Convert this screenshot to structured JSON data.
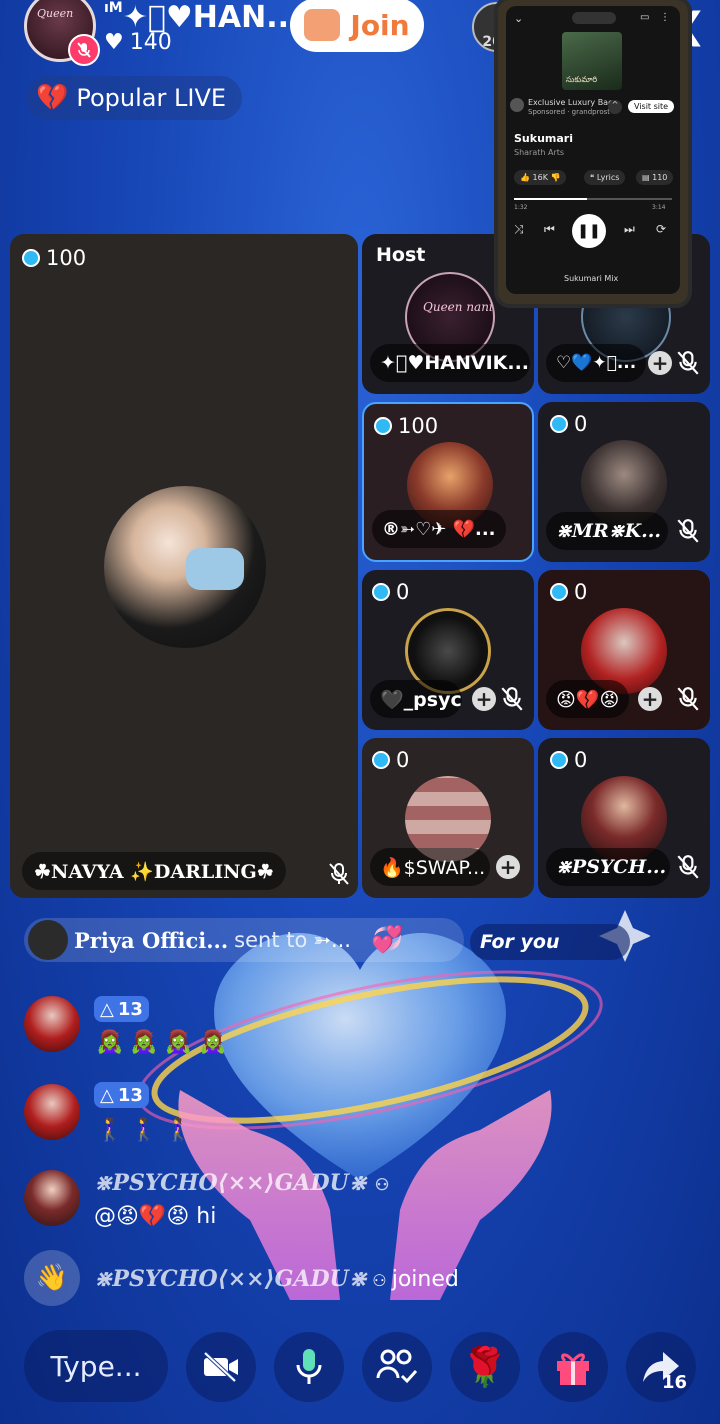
{
  "header": {
    "host_name": "✦⃝♥HAN...",
    "host_name_prefix": "ıM",
    "likes": "140",
    "join_label": "Join",
    "badge_text": "202",
    "popular_label": "Popular LIVE",
    "back_icon": "chevron-right-icon"
  },
  "mini_player": {
    "ad_title": "Exclusive Luxury Bag...",
    "ad_sub": "Sponsored · grandprost",
    "visit_label": "Visit site",
    "song": "Sukumari",
    "artist": "Sharath Arts",
    "likes": "16K",
    "lyrics_label": "Lyrics",
    "comments": "110",
    "elapsed": "1:32",
    "duration": "3:14",
    "progress": 0.46,
    "next_label": "Sukumari Mix",
    "cover_text": "సుకుమారి"
  },
  "seats": {
    "main": {
      "count": "100",
      "name": "☘NAVYA ✨DARLING☘"
    },
    "host": {
      "tag": "Host",
      "name": "✦⃝♥HANVIK...",
      "avatar_text": "Queen nani"
    },
    "seat2": {
      "name": "♡💙✦⃝..."
    },
    "seat3": {
      "count": "100",
      "name": "®➳♡✈ 💔..."
    },
    "seat4": {
      "count": "0",
      "name": "⋇MR⋇K..."
    },
    "seat5": {
      "count": "0",
      "name": "🖤_psyc..."
    },
    "seat6": {
      "count": "0",
      "name": "😡💔😡"
    },
    "seat7": {
      "count": "0",
      "name": "🔥$SWAP..."
    },
    "seat8": {
      "count": "0",
      "name": "⋇PSYCH..."
    }
  },
  "gift_banner": {
    "sender": "Priya Offici...",
    "sent_to": "sent to",
    "receiver": "➳...",
    "for_you": "For you"
  },
  "chat": [
    {
      "level": "13",
      "emojis": "🧟‍♀️ 🧟‍♀️ 🧟‍♀️ 🧟‍♀️"
    },
    {
      "level": "13",
      "emojis": "🚶‍♀️ 🚶‍♀️ 🚶‍♀️"
    },
    {
      "name": "⋇PSYCHO⟨××⟩GADU⋇",
      "message": "@😡💔😡 hi"
    },
    {
      "name": "⋇PSYCHO⟨××⟩GADU⋇",
      "message": "joined"
    }
  ],
  "bottom_bar": {
    "type_placeholder": "Type...",
    "share_count": "16"
  },
  "colors": {
    "background": "#1746b6",
    "join_text": "#f07a3c",
    "gift_box": "#ff4b7d",
    "mic_green": "#5fe0b8"
  }
}
